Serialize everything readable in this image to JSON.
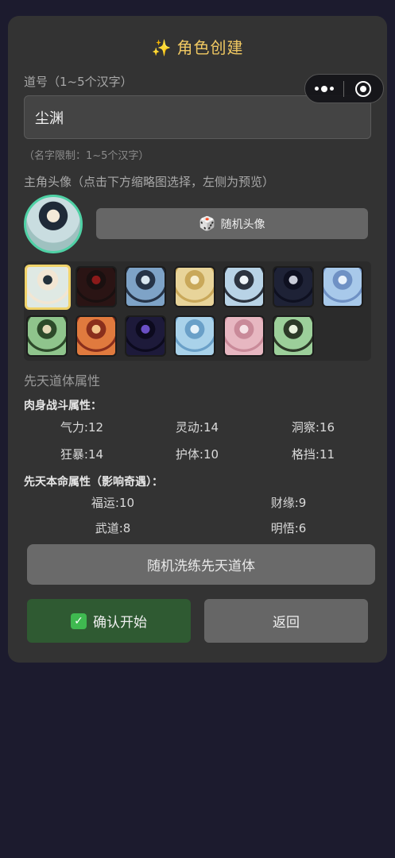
{
  "header": {
    "title": "角色创建",
    "title_icon": "sparkles-icon"
  },
  "capsule": {
    "more_icon": "more-dots-icon",
    "close_icon": "target-close-icon"
  },
  "name_field": {
    "label": "道号（1~5个汉字）",
    "value": "尘渊",
    "hint": "（名字限制：1~5个汉字）"
  },
  "avatar": {
    "label": "主角头像（点击下方缩略图选择，左侧为预览）",
    "random_button": "随机头像",
    "random_icon": "dice-icon",
    "selected_index": 0,
    "thumbnails": [
      {
        "colors": [
          "#dfe9e4",
          "#24313a",
          "#f2e6d3"
        ]
      },
      {
        "colors": [
          "#2a1414",
          "#8a1a1a",
          "#1a1010"
        ]
      },
      {
        "colors": [
          "#7ea3c7",
          "#d8e6f0",
          "#263448"
        ]
      },
      {
        "colors": [
          "#e8d49a",
          "#f7eed0",
          "#c9a85a"
        ]
      },
      {
        "colors": [
          "#b8d3e6",
          "#eef4f8",
          "#2c3440"
        ]
      },
      {
        "colors": [
          "#1e2236",
          "#c9ccd8",
          "#0e1020"
        ]
      },
      {
        "colors": [
          "#a8c9ea",
          "#e8f1fb",
          "#6f91c4"
        ]
      },
      {
        "colors": [
          "#8fc48c",
          "#e4d9b8",
          "#2d4a2a"
        ]
      },
      {
        "colors": [
          "#e07a3e",
          "#f3c48a",
          "#8a2f1c"
        ]
      },
      {
        "colors": [
          "#1d1a3a",
          "#6a4fc4",
          "#0c0a1e"
        ]
      },
      {
        "colors": [
          "#a9d2ea",
          "#e6f2fa",
          "#6aa0c8"
        ]
      },
      {
        "colors": [
          "#e7b7c1",
          "#f6e2e6",
          "#c98a99"
        ]
      },
      {
        "colors": [
          "#9ccf9a",
          "#eaf2de",
          "#2d3a28"
        ]
      }
    ]
  },
  "attributes": {
    "section_title": "先天道体属性",
    "body_title": "肉身战斗属性：",
    "body_stats": [
      {
        "name": "气力",
        "value": 12
      },
      {
        "name": "灵动",
        "value": 14
      },
      {
        "name": "洞察",
        "value": 16
      },
      {
        "name": "狂暴",
        "value": 14
      },
      {
        "name": "护体",
        "value": 10
      },
      {
        "name": "格挡",
        "value": 11
      }
    ],
    "fate_title": "先天本命属性（影响奇遇）：",
    "fate_stats": [
      {
        "name": "福运",
        "value": 10
      },
      {
        "name": "财缘",
        "value": 9
      },
      {
        "name": "武道",
        "value": 8
      },
      {
        "name": "明悟",
        "value": 6
      }
    ]
  },
  "actions": {
    "wash_button": "随机洗练先天道体",
    "confirm_button": "确认开始",
    "confirm_icon": "check-box-icon",
    "back_button": "返回"
  }
}
